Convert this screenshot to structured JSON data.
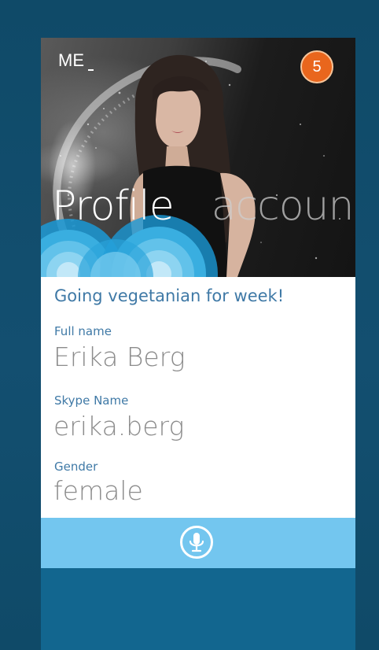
{
  "header": {
    "me_label": "ME",
    "notification_count": "5"
  },
  "pivot": {
    "active": "Profile",
    "next": "accoun"
  },
  "profile": {
    "mood": "Going vegetanian for week!",
    "fields": [
      {
        "label": "Full name",
        "value": "Erika Berg"
      },
      {
        "label": "Skype Name",
        "value": "erika.berg"
      },
      {
        "label": "Gender",
        "value": "female"
      }
    ]
  },
  "toolbar": {
    "mic_icon": "microphone-icon"
  },
  "colors": {
    "accent": "#3f79a6",
    "badge": "#e9661d",
    "mic_bar": "#73c6ef",
    "background": "#134f70"
  }
}
